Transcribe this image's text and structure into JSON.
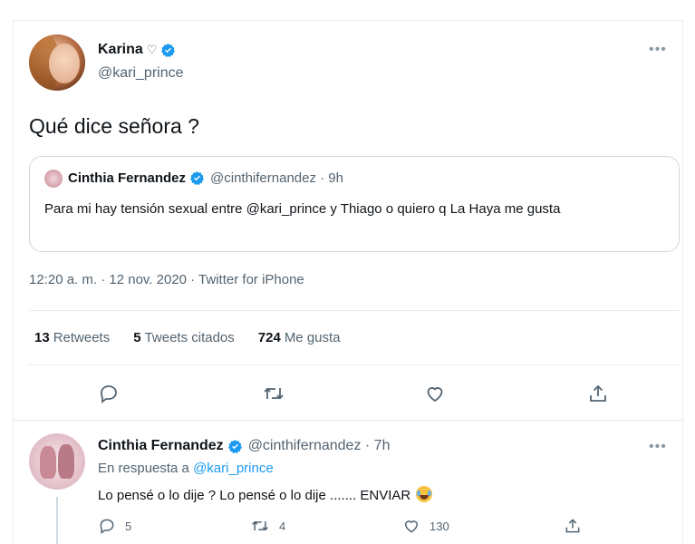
{
  "tweet": {
    "author_name": "Karina",
    "author_handle": "@kari_prince",
    "text": "Qué dice señora ?",
    "meta": "12:20 a. m. · 12 nov. 2020 · Twitter for iPhone"
  },
  "quote": {
    "author_name": "Cinthia Fernandez",
    "author_handle": "@cinthifernandez · 9h",
    "text": "Para mi hay tensión sexual entre @kari_prince y Thiago o quiero q La Haya me gusta"
  },
  "stats": {
    "retweets_count": "13",
    "retweets_label": "Retweets",
    "quotes_count": "5",
    "quotes_label": "Tweets citados",
    "likes_count": "724",
    "likes_label": "Me gusta"
  },
  "reply": {
    "author_name": "Cinthia Fernandez",
    "author_handle": "@cinthifernandez · 7h",
    "reply_to_prefix": "En respuesta a",
    "reply_to_handle": "@kari_prince",
    "text": "Lo pensé o lo dije ? Lo pensé o lo dije ....... ENVIAR",
    "replies": "5",
    "retweets": "4",
    "likes": "130"
  },
  "more_label": "•••",
  "icons": [
    "verified-badge-icon",
    "heart-outline-icon",
    "reply-icon",
    "retweet-icon",
    "like-icon",
    "share-icon",
    "more-icon",
    "laughing-emoji-icon"
  ],
  "colors": {
    "verified": "#1d9bf0",
    "icon_gray": "#536471",
    "border": "#cfd9de"
  }
}
